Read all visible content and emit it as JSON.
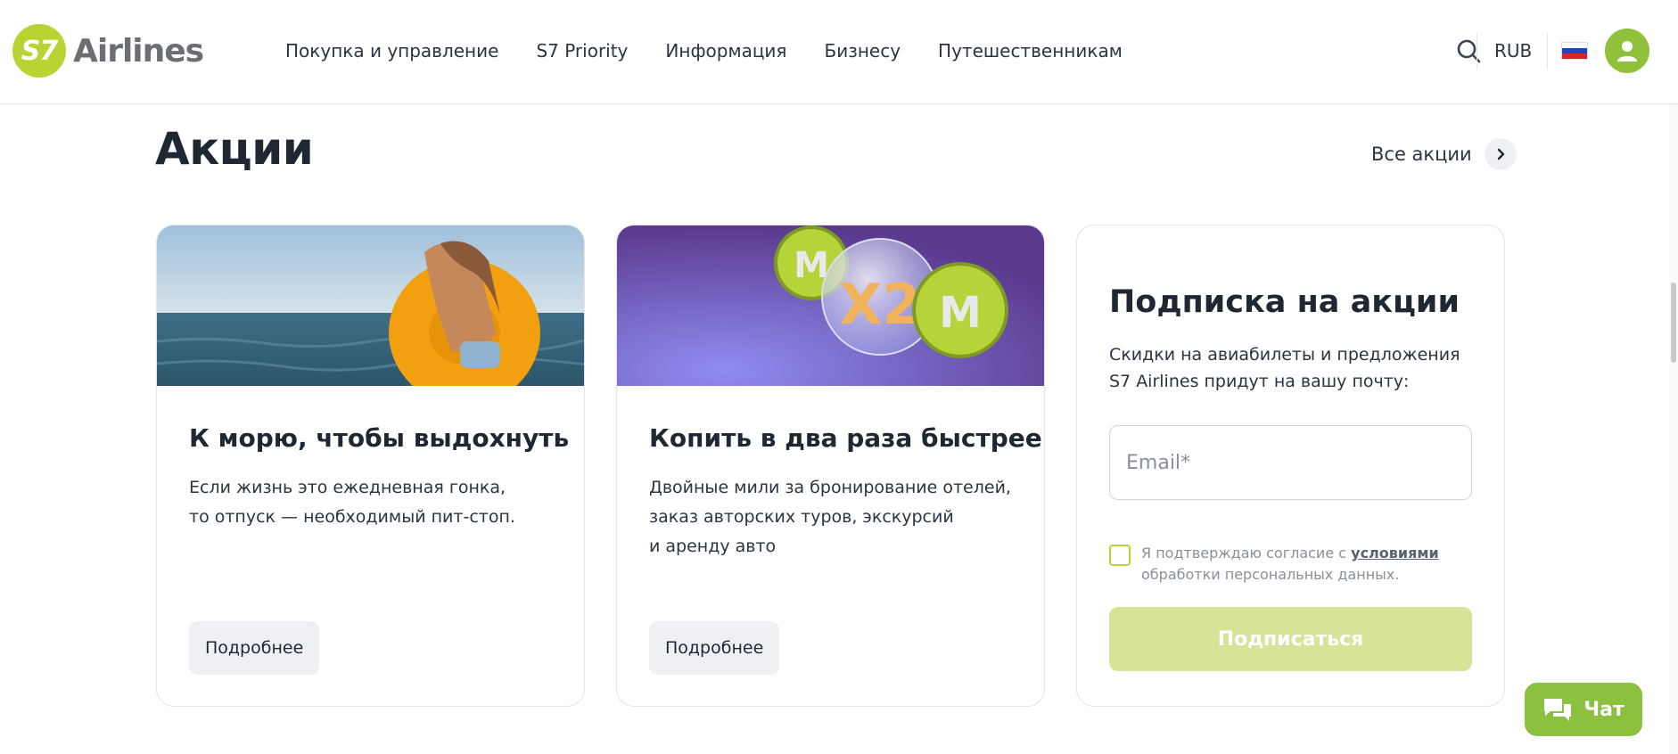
{
  "header": {
    "logo_mark": "S7",
    "logo_text": "Airlines",
    "nav": [
      {
        "label": "Покупка и управление"
      },
      {
        "label": "S7 Priority"
      },
      {
        "label": "Информация"
      },
      {
        "label": "Бизнесу"
      },
      {
        "label": "Путешественникам"
      }
    ],
    "currency": "RUB",
    "search_icon": "search-icon",
    "flag_icon": "russia-flag-icon",
    "avatar_icon": "user-avatar-icon"
  },
  "section": {
    "title": "Акции",
    "all_link": "Все акции"
  },
  "cards": [
    {
      "title": "К морю, чтобы выдохнуть",
      "text_lines": [
        "Если жизнь это ежедневная гонка,",
        "то отпуск — необходимый пит-стоп."
      ],
      "button": "Подробнее",
      "image": "sea-woman-float-image"
    },
    {
      "title": "Копить в два раза быстрее",
      "text_lines": [
        "Двойные мили за бронирование отелей,",
        "заказ авторских туров, экскурсий",
        "и аренду авто"
      ],
      "button": "Подробнее",
      "image": "double-miles-image",
      "image_badges": [
        "M",
        "X2",
        "M"
      ]
    }
  ],
  "subscribe": {
    "title": "Подписка на акции",
    "text_lines": [
      "Скидки на авиабилеты и предложения",
      "S7 Airlines придут на вашу почту:"
    ],
    "email_placeholder": "Email*",
    "consent_prefix": "Я подтверждаю согласие с ",
    "consent_link": "условиями",
    "consent_suffix": "обработки персональных данных.",
    "button": "Подписаться"
  },
  "chat": {
    "label": "Чат"
  },
  "colors": {
    "brand": "#b8d433",
    "chat": "#8cc13f",
    "subscribe_disabled": "#d5e497"
  }
}
